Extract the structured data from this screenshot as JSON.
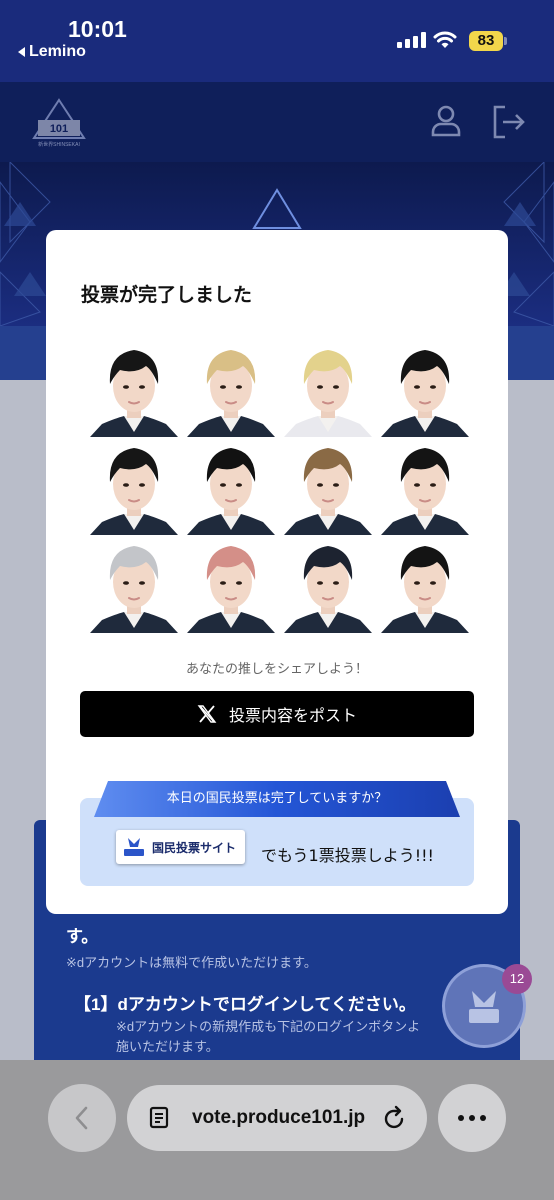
{
  "status_bar": {
    "time": "10:01",
    "back_app": "Lemino",
    "battery": "83",
    "battery_color": "#f2d64b"
  },
  "header": {
    "logo": "PRODUCE 101 JAPAN SHINSEKAI",
    "icons": [
      "user-icon",
      "logout-icon"
    ]
  },
  "modal": {
    "title": "投票が完了しました",
    "trainee_rows": 3,
    "trainee_columns": 4,
    "trainee_hair_colors": [
      "#161616",
      "#d9bf86",
      "#e3d28c",
      "#141414",
      "#161616",
      "#121212",
      "#8a6a45",
      "#141414",
      "#c3c5c9",
      "#d48f88",
      "#1d2330",
      "#141414"
    ],
    "share_prompt": "あなたの推しをシェアしよう！",
    "post_button": "投票内容をポスト",
    "national_vote": {
      "ribbon": "本日の国民投票は完了していますか？",
      "site_button": "国民投票サイト",
      "tail": "でもう1票投票しよう!!!"
    }
  },
  "page_behind": {
    "line1": "す。",
    "line2": "※dアカウントは無料で作成いただけます。",
    "line3": "【1】dアカウントでログインしてください。",
    "line4": "※dアカウントの新規作成も下記のログインボタンよ",
    "line5": "施いただけます。",
    "badge_count": "12"
  },
  "browser": {
    "url": "vote.produce101.jp"
  },
  "colors": {
    "header_blue": "#1a2b7c",
    "ribbon_blue": "#2d5fd0",
    "box_light_blue": "#cfe0fa"
  }
}
